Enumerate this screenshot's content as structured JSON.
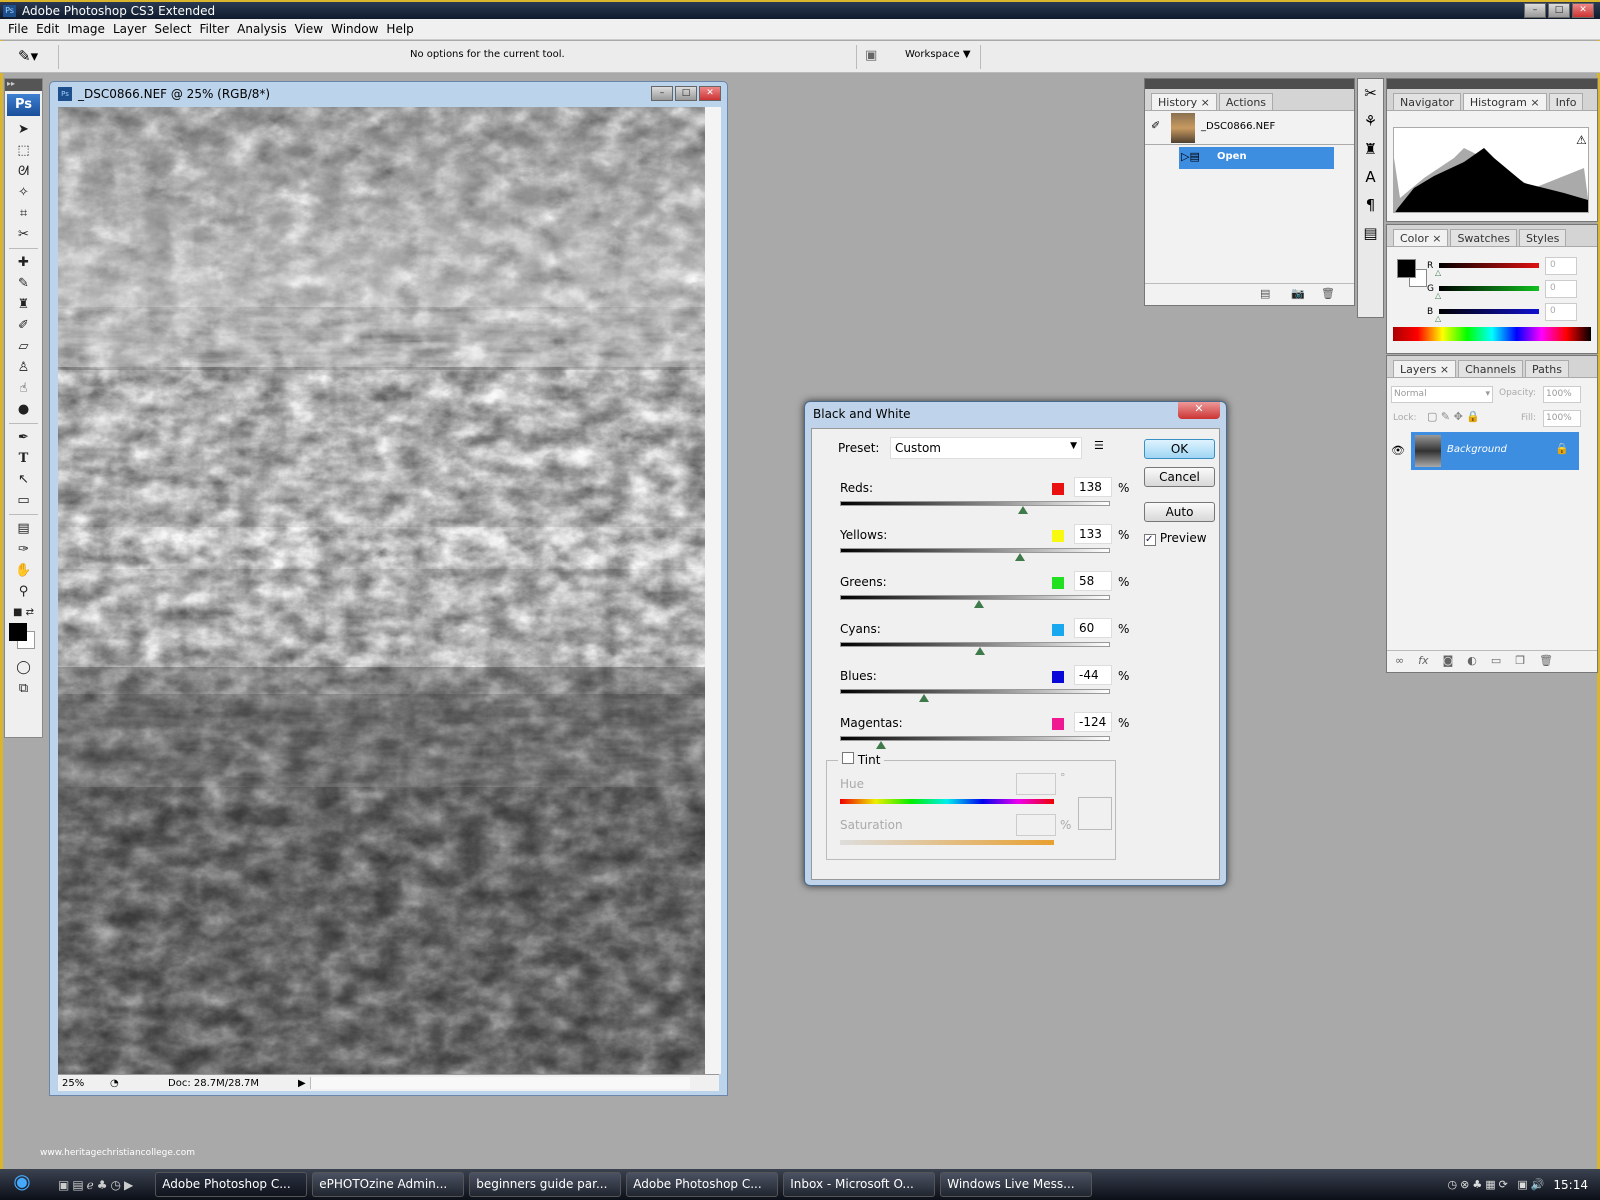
{
  "app": {
    "title": "Adobe Photoshop CS3 Extended",
    "icon": "ps-icon"
  },
  "menu": [
    "File",
    "Edit",
    "Image",
    "Layer",
    "Select",
    "Filter",
    "Analysis",
    "View",
    "Window",
    "Help"
  ],
  "options": {
    "message": "No options for the current tool.",
    "workspace": "Workspace"
  },
  "toolbox": {
    "logo": "Ps",
    "tools": [
      "move",
      "marquee",
      "lasso",
      "magic-wand",
      "crop",
      "slice",
      "healing",
      "brush",
      "stamp",
      "history-brush",
      "eraser",
      "paint-bucket",
      "blur",
      "dodge",
      "pen",
      "type",
      "path-select",
      "shape",
      "notes",
      "eyedropper",
      "hand",
      "zoom"
    ]
  },
  "document": {
    "title": "_DSC0866.NEF @ 25% (RGB/8*)",
    "zoom": "25%",
    "doc_size": "Doc: 28.7M/28.7M"
  },
  "history": {
    "tabs": [
      "History",
      "Actions"
    ],
    "snapshot": "_DSC0866.NEF",
    "items": [
      {
        "label": "Open",
        "selected": true
      }
    ]
  },
  "navigator": {
    "tabs": [
      "Navigator",
      "Histogram",
      "Info"
    ],
    "active": "Histogram"
  },
  "color": {
    "tabs": [
      "Color",
      "Swatches",
      "Styles"
    ],
    "channels": [
      {
        "name": "R",
        "value": "0",
        "color": "#e01010"
      },
      {
        "name": "G",
        "value": "0",
        "color": "#10c020"
      },
      {
        "name": "B",
        "value": "0",
        "color": "#1010d0"
      }
    ]
  },
  "layers": {
    "tabs": [
      "Layers",
      "Channels",
      "Paths"
    ],
    "blend_mode": "Normal",
    "opacity_label": "Opacity:",
    "opacity": "100%",
    "lock_label": "Lock:",
    "fill_label": "Fill:",
    "fill": "100%",
    "items": [
      {
        "name": "Background",
        "locked": true,
        "visible": true
      }
    ]
  },
  "dialog": {
    "title": "Black and White",
    "preset_label": "Preset:",
    "preset": "Custom",
    "ok": "OK",
    "cancel": "Cancel",
    "auto": "Auto",
    "preview_label": "Preview",
    "preview_checked": true,
    "slider_range": [
      -200,
      300
    ],
    "channels": [
      {
        "label": "Reds:",
        "value": 138,
        "color": "#e81010"
      },
      {
        "label": "Yellows:",
        "value": 133,
        "color": "#f8f810"
      },
      {
        "label": "Greens:",
        "value": 58,
        "color": "#20e020"
      },
      {
        "label": "Cyans:",
        "value": 60,
        "color": "#18a8f0"
      },
      {
        "label": "Blues:",
        "value": -44,
        "color": "#0808d8"
      },
      {
        "label": "Magentas:",
        "value": -124,
        "color": "#f01890"
      }
    ],
    "pct": "%",
    "tint_label": "Tint",
    "tint_checked": false,
    "hue_label": "Hue",
    "hue_unit": "°",
    "saturation_label": "Saturation",
    "sat_unit": "%"
  },
  "watermark": "www.heritagechristiancollege.com",
  "taskbar": {
    "items": [
      {
        "label": "Adobe Photoshop C...",
        "active": true
      },
      {
        "label": "ePHOTOzine Admin..."
      },
      {
        "label": "beginners guide par..."
      },
      {
        "label": "Adobe Photoshop C..."
      },
      {
        "label": "Inbox - Microsoft O..."
      },
      {
        "label": "Windows Live Mess..."
      }
    ],
    "clock": "15:14"
  }
}
